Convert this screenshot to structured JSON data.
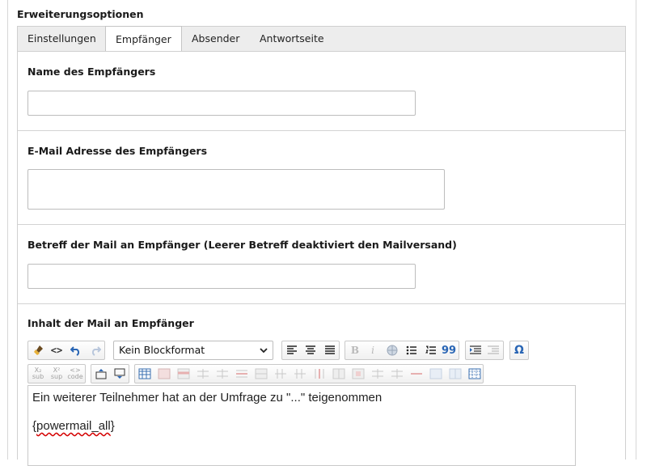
{
  "section_title": "Erweiterungsoptionen",
  "tabs": [
    {
      "label": "Einstellungen",
      "active": false
    },
    {
      "label": "Empfänger",
      "active": true
    },
    {
      "label": "Absender",
      "active": false
    },
    {
      "label": "Antwortseite",
      "active": false
    }
  ],
  "fields": {
    "receiver_name": {
      "label": "Name des Empfängers",
      "value": ""
    },
    "receiver_email": {
      "label": "E-Mail Adresse des Empfängers",
      "value": ""
    },
    "subject": {
      "label": "Betreff der Mail an Empfänger (Leerer Betreff deaktiviert den Mailversand)",
      "value": ""
    },
    "body": {
      "label": "Inhalt der Mail an Empfänger"
    }
  },
  "editor": {
    "blockformat": "Kein Blockformat",
    "line1": "Ein weiterer Teilnehmer hat an der Umfrage zu \"...\" teigenommen",
    "line2_open": "{",
    "line2_word": "powermail_all",
    "line2_close": "}",
    "sub_label": "sub",
    "sup_label": "sup",
    "code_label": "code",
    "sub_glyph": "X₂",
    "sup_glyph": "X²",
    "code_glyph": "<>",
    "source_glyph": "<>",
    "omega_glyph": "Ω",
    "quote_glyph": "99",
    "bold_glyph": "B",
    "italic_glyph": "i"
  },
  "colors": {
    "accent": "#2a66b5",
    "border": "#c9c9c9",
    "tabbar": "#ededed"
  }
}
